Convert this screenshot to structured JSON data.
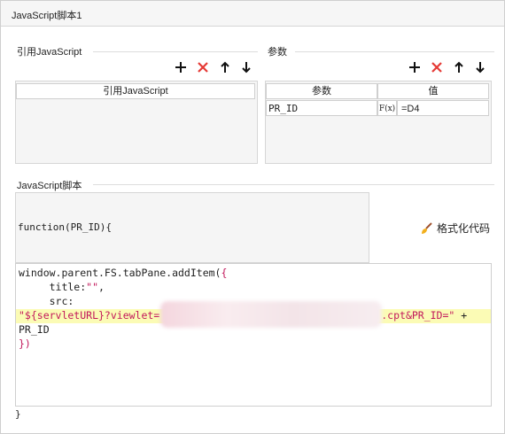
{
  "window": {
    "tab_title": "JavaScript脚本1"
  },
  "ref_section": {
    "label": "引用JavaScript",
    "column_header": "引用JavaScript",
    "icons": [
      "plus-icon",
      "delete-icon",
      "arrow-up-icon",
      "arrow-down-icon"
    ]
  },
  "params_section": {
    "label": "参数",
    "headers": [
      "参数",
      "值"
    ],
    "rows": [
      {
        "name": "PR_ID",
        "formula_button": "F(x)",
        "value": "=D4"
      }
    ],
    "icons": [
      "plus-icon",
      "delete-icon",
      "arrow-up-icon",
      "arrow-down-icon"
    ]
  },
  "script_section": {
    "label": "JavaScript脚本",
    "function_signature": "function(PR_ID){",
    "format_button": "格式化代码",
    "closing_brace": "}",
    "code_lines": [
      {
        "plain": "window.parent.FS.tabPane.addItem(",
        "accent": "{"
      },
      {
        "plain": "     title:",
        "accent": "\"\"",
        "after": ","
      },
      {
        "plain": "     src:"
      },
      {
        "accent": "\"${servletURL}?viewlet=",
        "accent2": ".cpt&PR_ID=\"",
        "after": " +"
      },
      {
        "plain": "PR_ID"
      },
      {
        "accent": "})"
      }
    ]
  },
  "colors": {
    "accent": "#c2185b",
    "highlight": "#fbfbb5",
    "delete": "#e53935"
  }
}
